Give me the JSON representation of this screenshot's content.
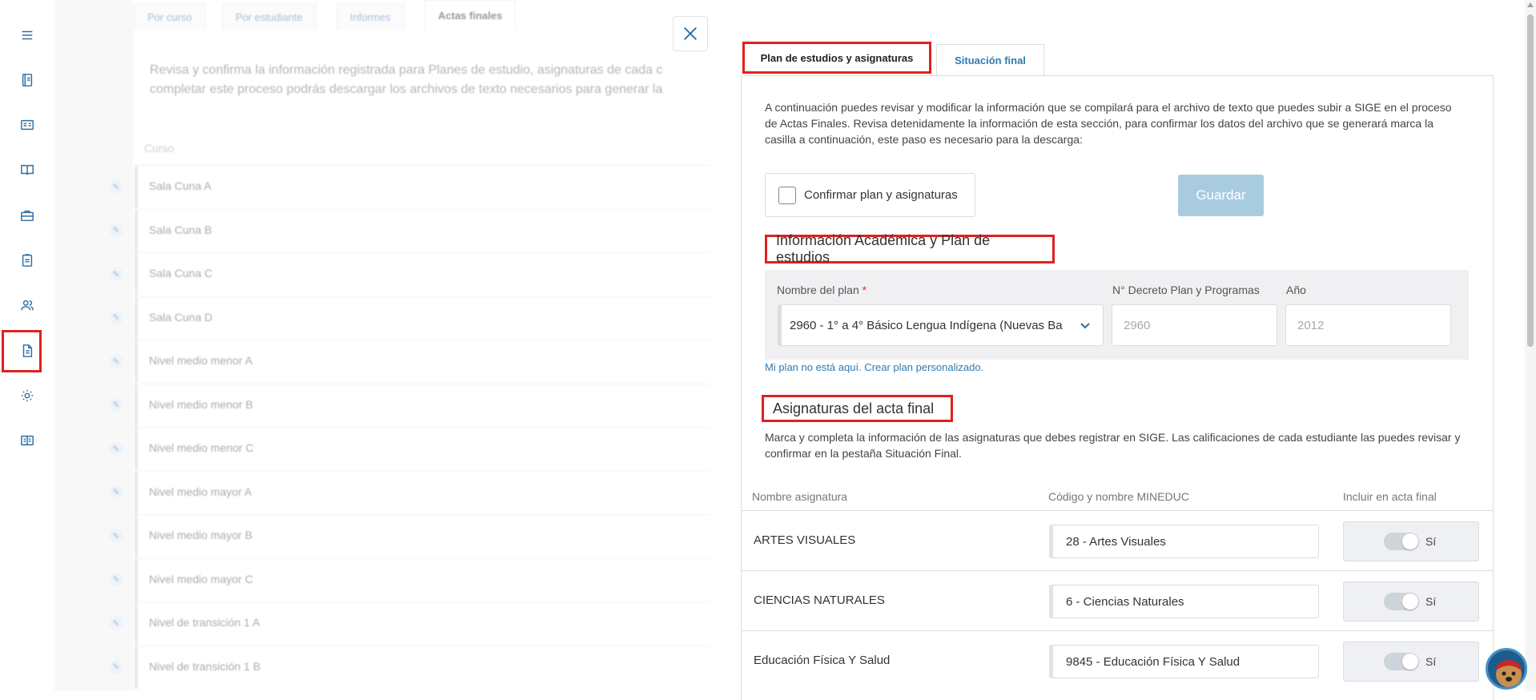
{
  "rail": {
    "icons": [
      "menu-icon",
      "notebook-icon",
      "id-card-icon",
      "book-icon",
      "briefcase-icon",
      "clipboard-icon",
      "users-icon",
      "document-icon",
      "gear-icon",
      "book-open-icon"
    ]
  },
  "background": {
    "tabs": [
      "Por curso",
      "Por estudiante",
      "Informes",
      "Actas finales"
    ],
    "intro_line1": "Revisa y confirma la información registrada para Planes de estudio, asignaturas de cada c",
    "intro_line2": "completar este proceso podrás descargar los archivos de texto necesarios para generar la",
    "column_header": "Curso",
    "courses": [
      "Sala Cuna A",
      "Sala Cuna B",
      "Sala Cuna C",
      "Sala Cuna D",
      "Nivel medio menor A",
      "Nivel medio menor B",
      "Nivel medio menor C",
      "Nivel medio mayor A",
      "Nivel medio mayor B",
      "Nivel medio mayor C",
      "Nivel de transición 1 A",
      "Nivel de transición 1 B"
    ]
  },
  "panel": {
    "tabs": {
      "plan": "Plan de estudios y asignaturas",
      "situacion": "Situación final"
    },
    "intro": "A continuación puedes revisar y modificar la información que se compilará para el archivo de texto que puedes subir a SIGE en el proceso de Actas Finales. Revisa detenidamente la información de esta sección, para confirmar los datos del archivo que se generará marca la casilla a continuación, este paso es necesario para la descarga:",
    "confirm_label": "Confirmar plan y asignaturas",
    "save_label": "Guardar",
    "section_info": "Información Académica y Plan de estudios",
    "plan_label": "Nombre del plan",
    "plan_required": "*",
    "plan_value": "2960 - 1° a 4° Básico Lengua Indígena (Nuevas Ba",
    "decreto_label": "N° Decreto Plan y Programas",
    "decreto_value": "2960",
    "anio_label": "Año",
    "anio_value": "2012",
    "custom_plan_link": "Mi plan no está aquí. Crear plan personalizado.",
    "section_asig": "Asignaturas del acta final",
    "asig_intro": "Marca y completa la información de las asignaturas que debes registrar en SIGE. Las calificaciones de cada estudiante las puedes revisar y confirmar en la pestaña Situación Final.",
    "headers": {
      "name": "Nombre asignatura",
      "code": "Código y nombre MINEDUC",
      "include": "Incluir en acta final"
    },
    "subjects": [
      {
        "name": "ARTES VISUALES",
        "code": "28 - Artes Visuales",
        "include": "Sí",
        "included": true
      },
      {
        "name": "CIENCIAS NATURALES",
        "code": "6 - Ciencias Naturales",
        "include": "Sí",
        "included": true
      },
      {
        "name": "Educación Física Y Salud",
        "code": "9845 - Educación Física Y Salud",
        "include": "Sí",
        "included": true
      }
    ]
  },
  "colors": {
    "accent": "#2c6ea5",
    "highlight": "#e02020",
    "save_disabled": "#a9cbe0"
  }
}
